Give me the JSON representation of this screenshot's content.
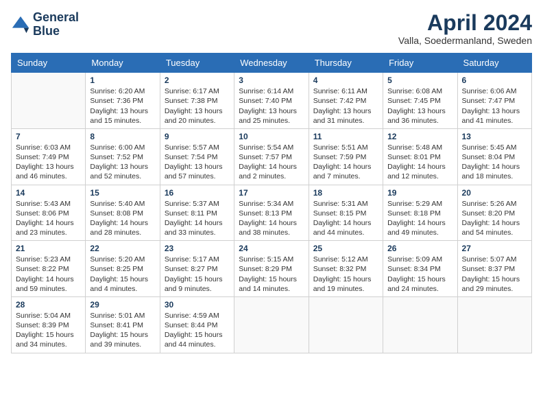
{
  "header": {
    "logo_line1": "General",
    "logo_line2": "Blue",
    "month_title": "April 2024",
    "subtitle": "Valla, Soedermanland, Sweden"
  },
  "days_of_week": [
    "Sunday",
    "Monday",
    "Tuesday",
    "Wednesday",
    "Thursday",
    "Friday",
    "Saturday"
  ],
  "weeks": [
    [
      {
        "day": "",
        "info": ""
      },
      {
        "day": "1",
        "info": "Sunrise: 6:20 AM\nSunset: 7:36 PM\nDaylight: 13 hours\nand 15 minutes."
      },
      {
        "day": "2",
        "info": "Sunrise: 6:17 AM\nSunset: 7:38 PM\nDaylight: 13 hours\nand 20 minutes."
      },
      {
        "day": "3",
        "info": "Sunrise: 6:14 AM\nSunset: 7:40 PM\nDaylight: 13 hours\nand 25 minutes."
      },
      {
        "day": "4",
        "info": "Sunrise: 6:11 AM\nSunset: 7:42 PM\nDaylight: 13 hours\nand 31 minutes."
      },
      {
        "day": "5",
        "info": "Sunrise: 6:08 AM\nSunset: 7:45 PM\nDaylight: 13 hours\nand 36 minutes."
      },
      {
        "day": "6",
        "info": "Sunrise: 6:06 AM\nSunset: 7:47 PM\nDaylight: 13 hours\nand 41 minutes."
      }
    ],
    [
      {
        "day": "7",
        "info": "Sunrise: 6:03 AM\nSunset: 7:49 PM\nDaylight: 13 hours\nand 46 minutes."
      },
      {
        "day": "8",
        "info": "Sunrise: 6:00 AM\nSunset: 7:52 PM\nDaylight: 13 hours\nand 52 minutes."
      },
      {
        "day": "9",
        "info": "Sunrise: 5:57 AM\nSunset: 7:54 PM\nDaylight: 13 hours\nand 57 minutes."
      },
      {
        "day": "10",
        "info": "Sunrise: 5:54 AM\nSunset: 7:57 PM\nDaylight: 14 hours\nand 2 minutes."
      },
      {
        "day": "11",
        "info": "Sunrise: 5:51 AM\nSunset: 7:59 PM\nDaylight: 14 hours\nand 7 minutes."
      },
      {
        "day": "12",
        "info": "Sunrise: 5:48 AM\nSunset: 8:01 PM\nDaylight: 14 hours\nand 12 minutes."
      },
      {
        "day": "13",
        "info": "Sunrise: 5:45 AM\nSunset: 8:04 PM\nDaylight: 14 hours\nand 18 minutes."
      }
    ],
    [
      {
        "day": "14",
        "info": "Sunrise: 5:43 AM\nSunset: 8:06 PM\nDaylight: 14 hours\nand 23 minutes."
      },
      {
        "day": "15",
        "info": "Sunrise: 5:40 AM\nSunset: 8:08 PM\nDaylight: 14 hours\nand 28 minutes."
      },
      {
        "day": "16",
        "info": "Sunrise: 5:37 AM\nSunset: 8:11 PM\nDaylight: 14 hours\nand 33 minutes."
      },
      {
        "day": "17",
        "info": "Sunrise: 5:34 AM\nSunset: 8:13 PM\nDaylight: 14 hours\nand 38 minutes."
      },
      {
        "day": "18",
        "info": "Sunrise: 5:31 AM\nSunset: 8:15 PM\nDaylight: 14 hours\nand 44 minutes."
      },
      {
        "day": "19",
        "info": "Sunrise: 5:29 AM\nSunset: 8:18 PM\nDaylight: 14 hours\nand 49 minutes."
      },
      {
        "day": "20",
        "info": "Sunrise: 5:26 AM\nSunset: 8:20 PM\nDaylight: 14 hours\nand 54 minutes."
      }
    ],
    [
      {
        "day": "21",
        "info": "Sunrise: 5:23 AM\nSunset: 8:22 PM\nDaylight: 14 hours\nand 59 minutes."
      },
      {
        "day": "22",
        "info": "Sunrise: 5:20 AM\nSunset: 8:25 PM\nDaylight: 15 hours\nand 4 minutes."
      },
      {
        "day": "23",
        "info": "Sunrise: 5:17 AM\nSunset: 8:27 PM\nDaylight: 15 hours\nand 9 minutes."
      },
      {
        "day": "24",
        "info": "Sunrise: 5:15 AM\nSunset: 8:29 PM\nDaylight: 15 hours\nand 14 minutes."
      },
      {
        "day": "25",
        "info": "Sunrise: 5:12 AM\nSunset: 8:32 PM\nDaylight: 15 hours\nand 19 minutes."
      },
      {
        "day": "26",
        "info": "Sunrise: 5:09 AM\nSunset: 8:34 PM\nDaylight: 15 hours\nand 24 minutes."
      },
      {
        "day": "27",
        "info": "Sunrise: 5:07 AM\nSunset: 8:37 PM\nDaylight: 15 hours\nand 29 minutes."
      }
    ],
    [
      {
        "day": "28",
        "info": "Sunrise: 5:04 AM\nSunset: 8:39 PM\nDaylight: 15 hours\nand 34 minutes."
      },
      {
        "day": "29",
        "info": "Sunrise: 5:01 AM\nSunset: 8:41 PM\nDaylight: 15 hours\nand 39 minutes."
      },
      {
        "day": "30",
        "info": "Sunrise: 4:59 AM\nSunset: 8:44 PM\nDaylight: 15 hours\nand 44 minutes."
      },
      {
        "day": "",
        "info": ""
      },
      {
        "day": "",
        "info": ""
      },
      {
        "day": "",
        "info": ""
      },
      {
        "day": "",
        "info": ""
      }
    ]
  ]
}
